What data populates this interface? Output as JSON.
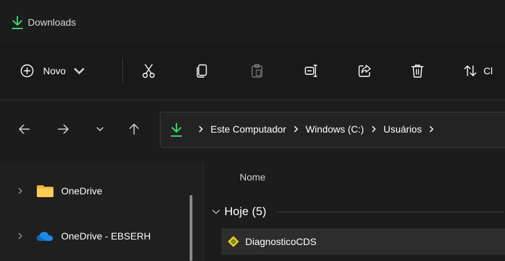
{
  "window": {
    "title": "Downloads",
    "title_icon": "download-arrow-icon",
    "accent_color": "#3bd16f"
  },
  "toolbar": {
    "new_label": "Novo",
    "new_icon": "plus-circle-icon",
    "cut_icon": "scissors-icon",
    "copy_icon": "copy-icon",
    "paste_icon": "clipboard-icon",
    "rename_icon": "rename-icon",
    "share_icon": "share-icon",
    "delete_icon": "trash-icon",
    "sort_icon": "sort-icon",
    "sort_label": "Cl"
  },
  "navigation": {
    "back_icon": "arrow-left-icon",
    "forward_icon": "arrow-right-icon",
    "recent_icon": "chevron-down-icon",
    "up_icon": "arrow-up-icon"
  },
  "address": {
    "icon": "download-arrow-icon",
    "crumbs": [
      "Este Computador",
      "Windows (C:)",
      "Usuários"
    ]
  },
  "sidebar": {
    "items": [
      {
        "label": "OneDrive",
        "icon": "folder-icon"
      },
      {
        "label": "OneDrive - EBSERH",
        "icon": "cloud-icon"
      }
    ]
  },
  "content": {
    "column_name": "Nome",
    "group_label": "Hoje (5)",
    "files": [
      {
        "name": "DiagnosticoCDS",
        "icon": "diamond-app-icon"
      }
    ]
  }
}
